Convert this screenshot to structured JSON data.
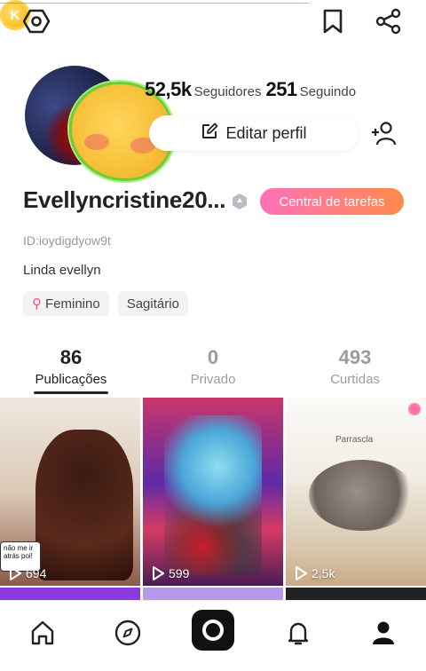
{
  "header": {
    "icons": [
      "hexagon-settings-icon",
      "coin-icon",
      "bookmark-icon",
      "share-icon"
    ],
    "coin_letter": "K"
  },
  "profile": {
    "followers_count": "52,5k",
    "followers_label": "Seguidores",
    "following_count": "251",
    "following_label": "Seguindo",
    "edit_profile_label": "Editar perfil",
    "username": "Evellyncristine20...",
    "tasks_label": "Central de tarefas",
    "user_id": "ID:ioydigdyow9t",
    "bio": "Linda evellyn",
    "tags": [
      "Feminino",
      "Sagitário"
    ]
  },
  "tabs": [
    {
      "count": "86",
      "label": "Publicações",
      "active": true
    },
    {
      "count": "0",
      "label": "Privado",
      "active": false
    },
    {
      "count": "493",
      "label": "Curtidas",
      "active": false
    }
  ],
  "posts": [
    {
      "plays": "694",
      "caption": "",
      "speech": "não me ir atrás poi!"
    },
    {
      "plays": "599",
      "caption": ""
    },
    {
      "plays": "2,5k",
      "caption": "Parrascla"
    }
  ],
  "colors": {
    "accent_gradient_start": "#ff71b9",
    "accent_gradient_end": "#ff8a4a",
    "coin": "#ffc22c"
  },
  "bottom_nav": [
    "home-icon",
    "compass-icon",
    "camera-icon",
    "bell-icon",
    "profile-icon"
  ]
}
